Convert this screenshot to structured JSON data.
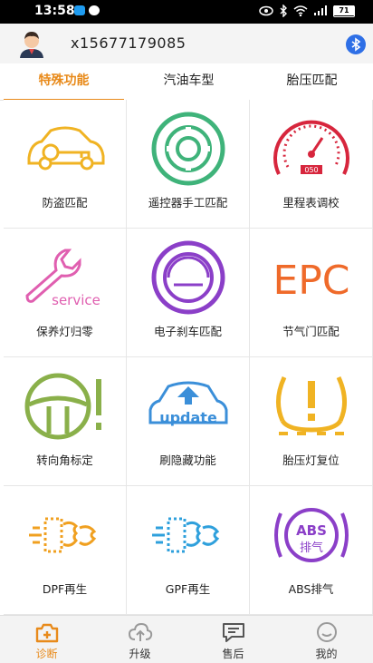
{
  "status_bar": {
    "time": "13:58",
    "battery": "71"
  },
  "header": {
    "account": "x15677179085"
  },
  "tabs": [
    {
      "label": "特殊功能",
      "active": true
    },
    {
      "label": "汽油车型",
      "active": false
    },
    {
      "label": "胎压匹配",
      "active": false
    }
  ],
  "functions": [
    {
      "label": "防盗匹配",
      "icon": "car-key-icon"
    },
    {
      "label": "遥控器手工匹配",
      "icon": "remote-icon"
    },
    {
      "label": "里程表调校",
      "icon": "odometer-icon"
    },
    {
      "label": "保养灯归零",
      "icon": "service-wrench-icon"
    },
    {
      "label": "电子刹车匹配",
      "icon": "brake-icon"
    },
    {
      "label": "节气门匹配",
      "icon": "epc-icon"
    },
    {
      "label": "转向角标定",
      "icon": "steering-icon"
    },
    {
      "label": "刷隐藏功能",
      "icon": "update-car-icon"
    },
    {
      "label": "胎压灯复位",
      "icon": "tpms-icon"
    },
    {
      "label": "DPF再生",
      "icon": "dpf-icon"
    },
    {
      "label": "GPF再生",
      "icon": "gpf-icon"
    },
    {
      "label": "ABS排气",
      "icon": "abs-icon"
    }
  ],
  "icon_text": {
    "service": "service",
    "epc": "EPC",
    "update": "update",
    "abs": "ABS",
    "abs_sub": "排气",
    "odo": "050"
  },
  "bottom_nav": [
    {
      "label": "诊断",
      "active": true
    },
    {
      "label": "升级",
      "active": false
    },
    {
      "label": "售后",
      "active": false
    },
    {
      "label": "我的",
      "active": false
    }
  ],
  "colors": {
    "accent": "#e88a1a",
    "yellow": "#f0b323",
    "green": "#3fb37a",
    "red": "#d7263d",
    "pink": "#e05fb0",
    "purple": "#8b3fc8",
    "orange": "#ef6a2a",
    "blue": "#3b8fd9",
    "olive": "#8ab04a"
  }
}
